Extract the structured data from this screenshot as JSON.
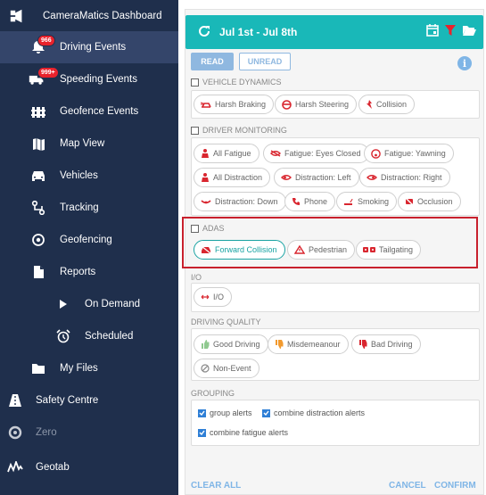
{
  "sidebar": {
    "app_title": "CameraMatics Dashboard",
    "items": [
      {
        "label": "Driving Events",
        "badge": "966"
      },
      {
        "label": "Speeding Events",
        "badge": "999+"
      },
      {
        "label": "Geofence Events"
      },
      {
        "label": "Map View"
      },
      {
        "label": "Vehicles"
      },
      {
        "label": "Tracking"
      },
      {
        "label": "Geofencing"
      },
      {
        "label": "Reports"
      },
      {
        "label": "On Demand"
      },
      {
        "label": "Scheduled"
      },
      {
        "label": "My Files"
      }
    ],
    "top_items": [
      {
        "label": "Safety Centre"
      },
      {
        "label": "Zero"
      },
      {
        "label": "Geotab"
      }
    ]
  },
  "header": {
    "date_range": "Jul 1st - Jul 8th"
  },
  "filters": {
    "read_label": "READ",
    "unread_label": "UNREAD",
    "vehicle_dynamics": {
      "title": "VEHICLE DYNAMICS",
      "chips": [
        "Harsh Braking",
        "Harsh Steering",
        "Collision"
      ]
    },
    "driver_monitoring": {
      "title": "DRIVER MONITORING",
      "chips": [
        "All Fatigue",
        "Fatigue: Eyes Closed",
        "Fatigue: Yawning",
        "All Distraction",
        "Distraction: Left",
        "Distraction: Right",
        "Distraction: Down",
        "Phone",
        "Smoking",
        "Occlusion"
      ]
    },
    "adas": {
      "title": "ADAS",
      "chips": [
        "Forward Collision",
        "Pedestrian",
        "Tailgating"
      ]
    },
    "io": {
      "title": "I/O",
      "chips": [
        "I/O"
      ]
    },
    "driving_quality": {
      "title": "DRIVING QUALITY",
      "chips": [
        "Good Driving",
        "Misdemeanour",
        "Bad Driving",
        "Non-Event"
      ]
    },
    "grouping": {
      "title": "GROUPING",
      "options": [
        "group alerts",
        "combine distraction alerts",
        "combine fatigue alerts"
      ]
    }
  },
  "footer": {
    "clear_all": "CLEAR ALL",
    "cancel": "CANCEL",
    "confirm": "CONFIRM"
  },
  "colors": {
    "sidebar_bg": "#1f2f4c",
    "header_teal": "#19b8b8",
    "chip_icon_red": "#d9262f",
    "selected_teal": "#1aa3a3",
    "highlight_red": "#c8202d",
    "link_blue": "#7fb5e6"
  }
}
